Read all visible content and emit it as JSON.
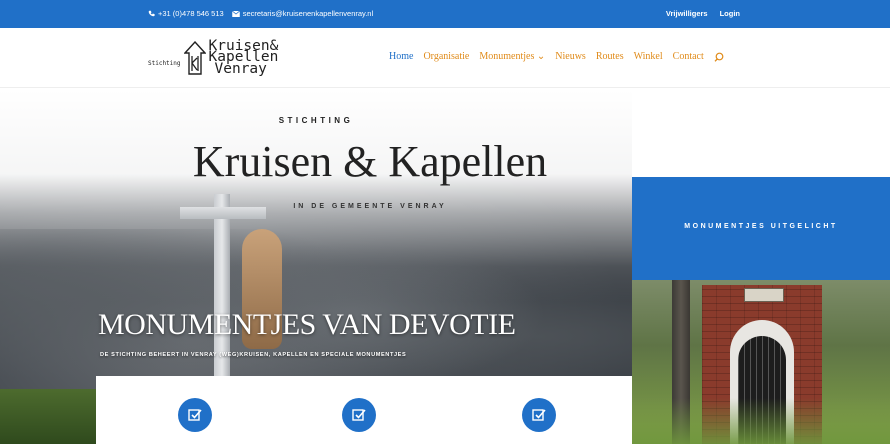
{
  "topbar": {
    "phone": "+31 (0)478 546 513",
    "email": "secretaris@kruisenenkapellenvenray.nl",
    "links": [
      "Vrijwilligers",
      "Login"
    ]
  },
  "logo": {
    "small": "Stichting",
    "line1": "Kruisen&",
    "line2": "Kapellen",
    "line3": "Venray"
  },
  "nav": {
    "items": [
      "Home",
      "Organisatie",
      "Monumentjes",
      "Nieuws",
      "Routes",
      "Winkel",
      "Contact"
    ],
    "active": "Home",
    "dropdown_marker": "⌄"
  },
  "hero": {
    "pretitle": "STICHTING",
    "title": "Kruisen & Kapellen",
    "subtitle": "IN DE GEMEENTE VENRAY",
    "headline": "MONUMENTJES VAN DEVOTIE",
    "tagline": "DE STICHTING BEHEERT IN VENRAY (WEG)KRUISEN, KAPELLEN EN SPECIALE MONUMENTJES"
  },
  "sidebar": {
    "heading": "MONUMENTJES UITGELICHT"
  },
  "colors": {
    "brand_blue": "#2070c8",
    "nav_orange": "#e08b1a"
  }
}
